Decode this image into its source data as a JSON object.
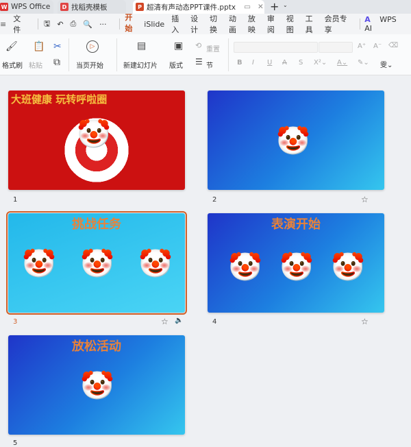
{
  "tabs": [
    {
      "label": "WPS Office",
      "icon": "wps-logo-icon"
    },
    {
      "label": "找稻壳模板",
      "icon": "docer-icon"
    },
    {
      "label": "超清有声动态PPT课件.pptx",
      "icon": "ppt-icon",
      "active": true
    }
  ],
  "menu": {
    "file": "文件",
    "items": [
      "开始",
      "iSlide",
      "插入",
      "设计",
      "切换",
      "动画",
      "放映",
      "审阅",
      "视图",
      "工具",
      "会员专享"
    ],
    "ai": "WPS AI"
  },
  "ribbon": {
    "format_painter": "格式刷",
    "paste": "粘贴",
    "play_from_current": "当页开始",
    "new_slide": "新建幻灯片",
    "layout": "版式",
    "section": "节",
    "reset": "重置"
  },
  "slides": [
    {
      "number": "1",
      "title": "大班健康  玩转呼啦圈"
    },
    {
      "number": "2",
      "title": ""
    },
    {
      "number": "3",
      "title": "挑战任务",
      "selected": true
    },
    {
      "number": "4",
      "title": "表演开始"
    },
    {
      "number": "5",
      "title": "放松活动"
    }
  ],
  "colors": {
    "accent": "#c7501f",
    "slide_title": "#e8823a"
  }
}
